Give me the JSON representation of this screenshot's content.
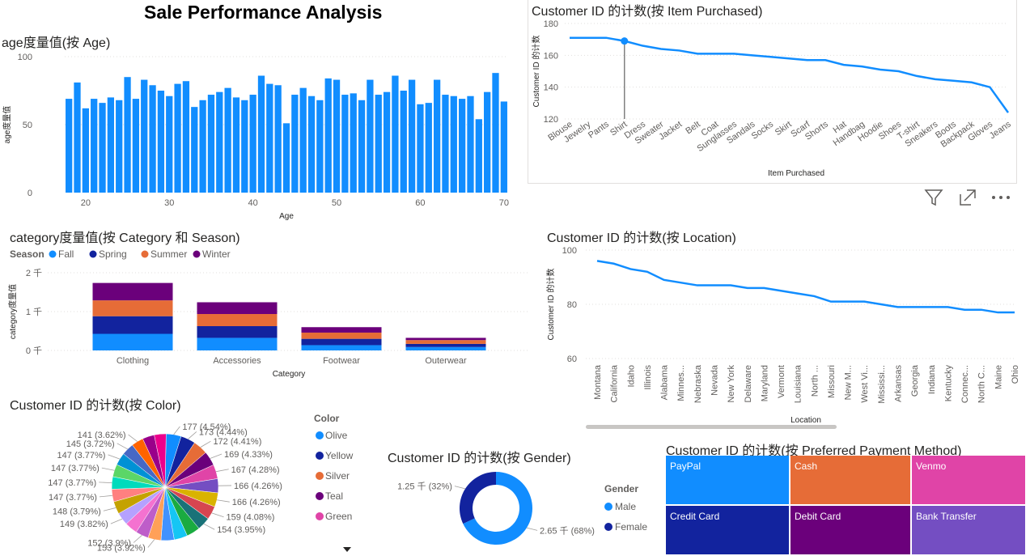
{
  "page": {
    "title": "Sale Performance Analysis",
    "colors": {
      "primary": "#118DFF",
      "navy": "#12239E",
      "orange": "#E66C37",
      "purple": "#6B007B",
      "pink": "#E044A7",
      "violet": "#744EC2"
    }
  },
  "toolbar": {
    "icons": [
      "filter-icon",
      "focus-mode-icon",
      "more-options-icon"
    ]
  },
  "chart_data": [
    {
      "id": "age",
      "type": "bar",
      "title": "age度量值(按 Age)",
      "xlabel": "Age",
      "ylabel": "age度量值",
      "xticks": [
        20,
        30,
        40,
        50,
        60,
        70
      ],
      "yticks": [
        0,
        50,
        100
      ],
      "ylim": [
        0,
        100
      ],
      "x": [
        18,
        19,
        20,
        21,
        22,
        23,
        24,
        25,
        26,
        27,
        28,
        29,
        30,
        31,
        32,
        33,
        34,
        35,
        36,
        37,
        38,
        39,
        40,
        41,
        42,
        43,
        44,
        45,
        46,
        47,
        48,
        49,
        50,
        51,
        52,
        53,
        54,
        55,
        56,
        57,
        58,
        59,
        60,
        61,
        62,
        63,
        64,
        65,
        66,
        67,
        68,
        69,
        70
      ],
      "values": [
        69,
        81,
        62,
        69,
        66,
        70,
        68,
        85,
        69,
        83,
        79,
        75,
        71,
        80,
        82,
        63,
        68,
        72,
        74,
        77,
        70,
        68,
        72,
        86,
        80,
        79,
        51,
        72,
        77,
        71,
        68,
        84,
        83,
        72,
        73,
        68,
        83,
        72,
        74,
        86,
        75,
        83,
        65,
        66,
        83,
        72,
        71,
        69,
        71,
        54,
        74,
        88,
        67
      ]
    },
    {
      "id": "item",
      "type": "line",
      "title": "Customer ID 的计数(按 Item Purchased)",
      "xlabel": "Item Purchased",
      "ylabel": "Customer ID 的计数",
      "yticks": [
        120,
        140,
        160,
        180
      ],
      "ylim": [
        120,
        180
      ],
      "categories": [
        "Blouse",
        "Jewelry",
        "Pants",
        "Shirt",
        "Dress",
        "Sweater",
        "Jacket",
        "Belt",
        "Coat",
        "Sunglasses",
        "Sandals",
        "Socks",
        "Skirt",
        "Scarf",
        "Shorts",
        "Hat",
        "Handbag",
        "Hoodie",
        "Shoes",
        "T-shirt",
        "Sneakers",
        "Boots",
        "Backpack",
        "Gloves",
        "Jeans"
      ],
      "values": [
        171,
        171,
        171,
        169,
        166,
        164,
        163,
        161,
        161,
        161,
        160,
        159,
        158,
        157,
        157,
        154,
        153,
        151,
        150,
        147,
        145,
        144,
        143,
        140,
        124
      ],
      "highlight_index": 3
    },
    {
      "id": "category",
      "type": "bar",
      "stacked": true,
      "title": "category度量值(按 Category 和 Season)",
      "xlabel": "Category",
      "ylabel": "category度量值",
      "yticks": [
        "0 千",
        "1 千",
        "2 千"
      ],
      "ylim": [
        0,
        2000
      ],
      "legend_title": "Season",
      "categories": [
        "Clothing",
        "Accessories",
        "Footwear",
        "Outerwear"
      ],
      "series": [
        {
          "name": "Fall",
          "color": "#118DFF",
          "values": [
            427,
            324,
            136,
            88
          ]
        },
        {
          "name": "Spring",
          "color": "#12239E",
          "values": [
            454,
            301,
            163,
            81
          ]
        },
        {
          "name": "Summer",
          "color": "#E66C37",
          "values": [
            408,
            312,
            160,
            97
          ]
        },
        {
          "name": "Winter",
          "color": "#6B007B",
          "values": [
            448,
            303,
            140,
            58
          ]
        }
      ]
    },
    {
      "id": "location",
      "type": "line",
      "title": "Customer ID 的计数(按 Location)",
      "xlabel": "Location",
      "ylabel": "Customer ID 的计数",
      "yticks": [
        60,
        80,
        100
      ],
      "ylim": [
        60,
        100
      ],
      "categories": [
        "Montana",
        "California",
        "Idaho",
        "Illinois",
        "Alabama",
        "Minnes...",
        "Nebraska",
        "Nevada",
        "New York",
        "Delaware",
        "Maryland",
        "Vermont",
        "Louisiana",
        "North ...",
        "Missouri",
        "New M...",
        "West Vi...",
        "Mississi...",
        "Arkansas",
        "Georgia",
        "Indiana",
        "Kentucky",
        "Connec...",
        "North C...",
        "Maine",
        "Ohio"
      ],
      "values": [
        96,
        95,
        93,
        92,
        89,
        88,
        87,
        87,
        87,
        86,
        86,
        85,
        84,
        83,
        81,
        81,
        81,
        80,
        79,
        79,
        79,
        79,
        78,
        78,
        77,
        77
      ]
    },
    {
      "id": "color",
      "type": "pie",
      "title": "Customer ID 的计数(按 Color)",
      "legend_title": "Color",
      "legend": [
        "Olive",
        "Yellow",
        "Silver",
        "Teal",
        "Green"
      ],
      "slices": [
        {
          "value": 177,
          "label": "177 (4.54%)",
          "color": "#118DFF"
        },
        {
          "value": 173,
          "label": "173 (4.44%)",
          "color": "#12239E"
        },
        {
          "value": 172,
          "label": "172 (4.41%)",
          "color": "#E66C37"
        },
        {
          "value": 169,
          "label": "169 (4.33%)",
          "color": "#6B007B"
        },
        {
          "value": 167,
          "label": "167 (4.28%)",
          "color": "#E044A7"
        },
        {
          "value": 166,
          "label": "166 (4.26%)",
          "color": "#744EC2"
        },
        {
          "value": 166,
          "label": "166 (4.26%)",
          "color": "#D9B300"
        },
        {
          "value": 159,
          "label": "159 (4.08%)",
          "color": "#D64550"
        },
        {
          "value": 154,
          "label": "154 (3.95%)",
          "color": "#197278"
        },
        {
          "value": 160,
          "label": "",
          "color": "#1AAB40"
        },
        {
          "value": 158,
          "label": "",
          "color": "#15C6F4"
        },
        {
          "value": 155,
          "label": "",
          "color": "#4092FF"
        },
        {
          "value": 153,
          "label": "153 (3.92%)",
          "color": "#FFA058"
        },
        {
          "value": 152,
          "label": "152 (3.9%)",
          "color": "#BE5DC9"
        },
        {
          "value": 150,
          "label": "",
          "color": "#F472D0"
        },
        {
          "value": 149,
          "label": "149 (3.82%)",
          "color": "#B5A1FF"
        },
        {
          "value": 148,
          "label": "148 (3.79%)",
          "color": "#C4A200"
        },
        {
          "value": 147,
          "label": "147 (3.77%)",
          "color": "#FF8080"
        },
        {
          "value": 147,
          "label": "147 (3.77%)",
          "color": "#00DBBC"
        },
        {
          "value": 147,
          "label": "147 (3.77%)",
          "color": "#5BD667"
        },
        {
          "value": 147,
          "label": "147 (3.77%)",
          "color": "#0091D5"
        },
        {
          "value": 145,
          "label": "145 (3.72%)",
          "color": "#4668C5"
        },
        {
          "value": 141,
          "label": "141 (3.62%)",
          "color": "#FF6300"
        },
        {
          "value": 140,
          "label": "",
          "color": "#99008A"
        },
        {
          "value": 139,
          "label": "",
          "color": "#EC008C"
        }
      ]
    },
    {
      "id": "gender",
      "type": "pie",
      "donut": true,
      "title": "Customer ID 的计数(按 Gender)",
      "legend_title": "Gender",
      "slices": [
        {
          "name": "Male",
          "value": 2652,
          "label": "2.65 千 (68%)",
          "color": "#118DFF"
        },
        {
          "name": "Female",
          "value": 1248,
          "label": "1.25 千 (32%)",
          "color": "#12239E"
        }
      ]
    },
    {
      "id": "payment",
      "type": "treemap",
      "title": "Customer ID 的计数(按 Preferred Payment Method)",
      "items": [
        {
          "name": "PayPal",
          "color": "#118DFF"
        },
        {
          "name": "Cash",
          "color": "#E66C37"
        },
        {
          "name": "Venmo",
          "color": "#E044A7"
        },
        {
          "name": "Credit Card",
          "color": "#12239E"
        },
        {
          "name": "Debit Card",
          "color": "#6B007B"
        },
        {
          "name": "Bank Transfer",
          "color": "#744EC2"
        }
      ]
    }
  ]
}
